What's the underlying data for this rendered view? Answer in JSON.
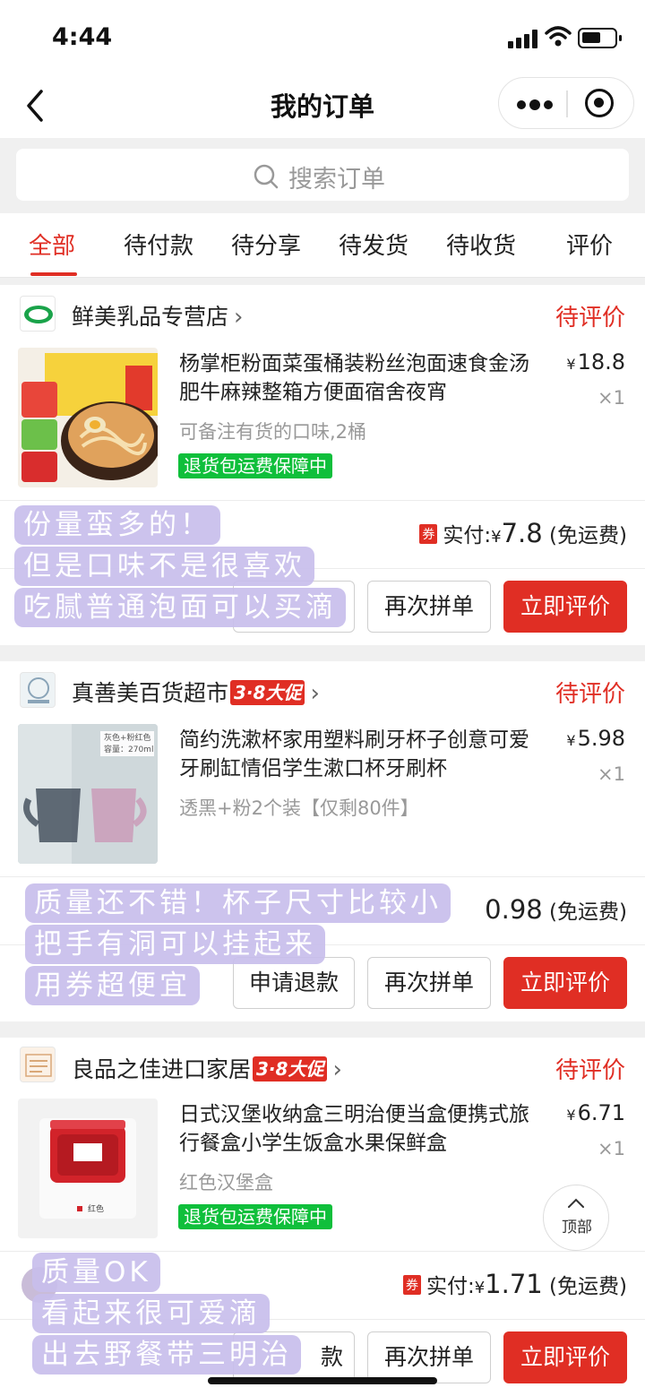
{
  "status_bar": {
    "time": "4:44"
  },
  "nav": {
    "title": "我的订单"
  },
  "search": {
    "placeholder": "搜索订单"
  },
  "tabs": [
    {
      "label": "全部",
      "active": true
    },
    {
      "label": "待付款"
    },
    {
      "label": "待分享"
    },
    {
      "label": "待发货"
    },
    {
      "label": "待收货"
    },
    {
      "label": "评价"
    }
  ],
  "orders": [
    {
      "shop": "鲜美乳品专营店",
      "promo": "",
      "status": "待评价",
      "title": "杨掌柜粉面菜蛋桶装粉丝泡面速食金汤肥牛麻辣整箱方便面宿舍夜宵",
      "price_symbol": "¥",
      "price": "18.8",
      "qty": "×1",
      "spec": "可备注有货的口味,2桶",
      "guarantee": "退货包运费保障中",
      "coupon": "券",
      "paid_label": "实付:",
      "paid_symbol": "¥",
      "paid_amount": "7.8",
      "shipping": "(免运费)",
      "buttons": {
        "reorder": "再次拼单",
        "review": "立即评价"
      },
      "note": [
        "份量蛮多的！",
        "但是口味不是很喜欢",
        "吃腻普通泡面可以买滴"
      ]
    },
    {
      "shop": "真善美百货超市",
      "promo": "3·8大促",
      "status": "待评价",
      "title": "简约洗漱杯家用塑料刷牙杯子创意可爱牙刷缸情侣学生漱口杯牙刷杯",
      "price_symbol": "¥",
      "price": "5.98",
      "qty": "×1",
      "spec": "透黑+粉2个装【仅剩80件】",
      "thumb_label_1": "灰色+粉红色",
      "thumb_label_2": "容量：270ml",
      "paid_amount_visible": "0.98",
      "shipping": "(免运费)",
      "buttons": {
        "refund": "申请退款",
        "reorder": "再次拼单",
        "review": "立即评价"
      },
      "note": [
        "质量还不错！杯子尺寸比较小",
        "把手有洞可以挂起来",
        "用券超便宜"
      ]
    },
    {
      "shop": "良品之佳进口家居",
      "promo": "3·8大促",
      "status": "待评价",
      "title": "日式汉堡收纳盒三明治便当盒便携式旅行餐盒小学生饭盒水果保鲜盒",
      "price_symbol": "¥",
      "price": "6.71",
      "qty": "×1",
      "spec": "红色汉堡盒",
      "thumb_label": "红色",
      "guarantee": "退货包运费保障中",
      "coupon": "券",
      "paid_label": "实付:",
      "paid_symbol": "¥",
      "paid_amount": "1.71",
      "shipping": "(免运费)",
      "buttons": {
        "refund_partial": "款",
        "reorder": "再次拼单",
        "review": "立即评价"
      },
      "note": [
        "质量OK",
        "看起来很可爱滴",
        "出去野餐带三明治"
      ]
    }
  ],
  "back_to_top": "顶部",
  "colors": {
    "accent": "#e02e24",
    "guarantee": "#0fbf3b",
    "note_bg": "#c8bfeb"
  }
}
